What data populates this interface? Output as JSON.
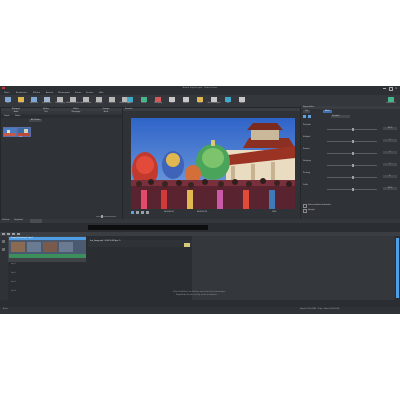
{
  "window": {
    "title": "Aurora Projekt.mp4 – Video Deluxe"
  },
  "menu": [
    "Datei",
    "Bearbeiten",
    "Effekte",
    "Ansicht",
    "Wiedergabe",
    "Extras",
    "Fenster",
    "Hilfe"
  ],
  "toolbar_left": [
    {
      "label": "Neu",
      "color": "#7fa7d6"
    },
    {
      "label": "Öffnen",
      "color": "#e0b84f"
    },
    {
      "label": "Speichern",
      "color": "#7fa7d6"
    },
    {
      "label": "Exportieren",
      "color": "#9fb5d0"
    },
    {
      "label": "Rückgängig",
      "color": "#b8b8b8"
    },
    {
      "label": "Wiederherstellen",
      "color": "#b8b8b8"
    },
    {
      "label": "Ausschneiden",
      "color": "#b8b8b8"
    },
    {
      "label": "Einfügen",
      "color": "#b8b8b8"
    },
    {
      "label": "Löschen",
      "color": "#b8b8b8"
    },
    {
      "label": "Einstellungen",
      "color": "#b8b8b8"
    }
  ],
  "toolbar_center": [
    {
      "label": "Import",
      "color": "#3fa9c9"
    },
    {
      "label": "Effekt",
      "color": "#46b58c"
    },
    {
      "label": "Übergang",
      "color": "#d45959"
    },
    {
      "label": "Titel",
      "color": "#c8c8c8"
    },
    {
      "label": "Schnitt",
      "color": "#c8c8c8"
    },
    {
      "label": "Farbe",
      "color": "#e0b84f"
    },
    {
      "label": "Geschwindigkeit",
      "color": "#c8c8c8"
    },
    {
      "label": "Ton",
      "color": "#3fa9c9"
    },
    {
      "label": "Audio",
      "color": "#c8c8c8"
    }
  ],
  "toolbar_right": {
    "label": "Exportieren",
    "color": "#46b58c"
  },
  "media_panel": {
    "tabs": [
      "Mediapool",
      "Medien",
      "Effekte",
      "Vorlagen",
      "Audio",
      "Titel",
      "Übergänge",
      "Musik"
    ],
    "subtabs": [
      "Projekt",
      "Videos"
    ],
    "filter_label": "Alle Medien",
    "items": [
      {
        "name": "Tempel_Festival.mp4",
        "label": ""
      },
      {
        "name": "Fest_Umzug.mp4",
        "label": "Fest"
      }
    ]
  },
  "preview": {
    "header": "Vorschau",
    "timecode_left": "00:00:00:00",
    "timecode_right": "00:00:15:08",
    "zoom": "100%"
  },
  "properties": {
    "header": "Eigenschaften",
    "tabs": [
      "Clip",
      "Effekt"
    ],
    "rows": [
      {
        "label": "Deckkraft",
        "value": "100 %"
      },
      {
        "label": "Helligkeit",
        "value": "0"
      },
      {
        "label": "Kontrast",
        "value": "0"
      },
      {
        "label": "Sättigung",
        "value": "0"
      },
      {
        "label": "Drehung",
        "value": "0°"
      },
      {
        "label": "Größe",
        "value": "100 %"
      }
    ],
    "checkbox1": "Seitenverhältnis beibehalten",
    "checkbox2": "Spiegeln",
    "dropdown_value": "Standard"
  },
  "timeline": {
    "tabs": [
      "Zeitleiste",
      "Storyboard"
    ],
    "track_labels": [
      "Spur 1",
      "Spur 2",
      "Spur 3",
      "Spur 4"
    ],
    "clip1_label": "Tempel_Festival.mp4 – Spur 1",
    "clip2_label": "Fest_Umzug.mp4 – 00:00:15:08 (Spur 1)",
    "hint": "Ziehen Sie Medien in die Zeitleiste, um sie dem Projekt hinzuzufügen.",
    "hint2": "Doppelklicken Sie auf einen Clip, um ihn zu bearbeiten."
  },
  "status": {
    "left": "Bereit",
    "right": "Projekt: 1920×1080 · 25 fps · Dauer 00:00:15:08"
  }
}
